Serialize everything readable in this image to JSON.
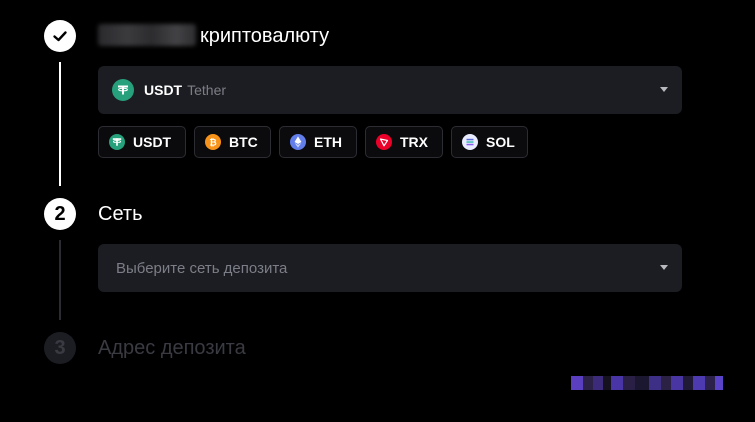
{
  "steps": [
    {
      "number": "1",
      "state": "done",
      "title_prefix_redacted": true,
      "title": "криптовалюту"
    },
    {
      "number": "2",
      "state": "active",
      "title": "Сеть"
    },
    {
      "number": "3",
      "state": "inactive",
      "title": "Адрес депозита"
    }
  ],
  "currency_select": {
    "symbol": "USDT",
    "name": "Tether",
    "icon": "usdt-icon"
  },
  "quick_picks": [
    {
      "label": "USDT",
      "icon": "usdt-icon",
      "color": "#26a17b"
    },
    {
      "label": "BTC",
      "icon": "btc-icon",
      "color": "#f7931a"
    },
    {
      "label": "ETH",
      "icon": "eth-icon",
      "color": "#627eea"
    },
    {
      "label": "TRX",
      "icon": "trx-icon",
      "color": "#eb0029"
    },
    {
      "label": "SOL",
      "icon": "sol-icon",
      "color": "#5a6bd8"
    }
  ],
  "network_select": {
    "placeholder": "Выберите сеть депозита"
  },
  "colors": {
    "background": "#000000",
    "field": "#1c1d22",
    "muted_text": "#7c7e87",
    "inactive": "#3a3b42"
  }
}
